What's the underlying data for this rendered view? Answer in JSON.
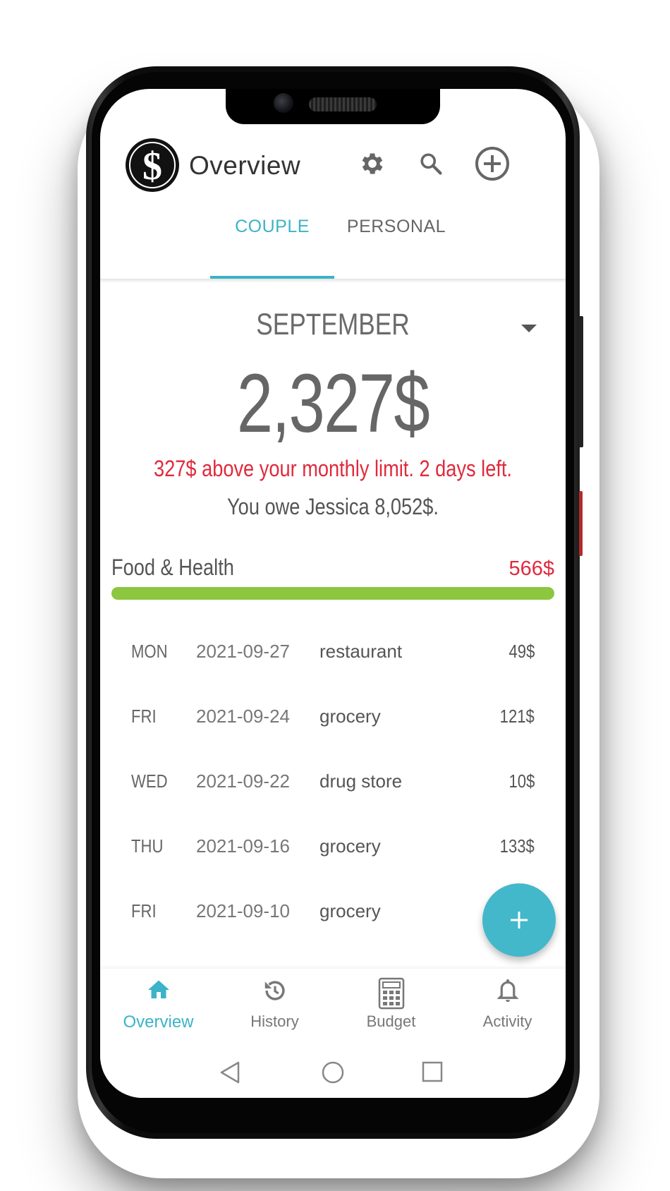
{
  "header": {
    "title": "Overview",
    "logo_icon": "dollar-logo-icon",
    "icons": [
      "gear-icon",
      "search-icon",
      "add-circle-icon"
    ]
  },
  "tabs": [
    {
      "label": "COUPLE",
      "active": true
    },
    {
      "label": "PERSONAL",
      "active": false
    }
  ],
  "summary": {
    "month": "SEPTEMBER",
    "total": "2,327$",
    "warning": "327$ above your monthly limit. 2 days left.",
    "owe": "You owe Jessica 8,052$."
  },
  "category": {
    "name": "Food & Health",
    "amount": "566$",
    "progress": 1.0,
    "bar_color": "#8dc63f"
  },
  "transactions": [
    {
      "day": "MON",
      "date": "2021-09-27",
      "description": "restaurant",
      "amount": "49$"
    },
    {
      "day": "FRI",
      "date": "2021-09-24",
      "description": "grocery",
      "amount": "121$"
    },
    {
      "day": "WED",
      "date": "2021-09-22",
      "description": "drug store",
      "amount": "10$"
    },
    {
      "day": "THU",
      "date": "2021-09-16",
      "description": "grocery",
      "amount": "133$"
    },
    {
      "day": "FRI",
      "date": "2021-09-10",
      "description": "grocery",
      "amount": ""
    }
  ],
  "bottom_nav": [
    {
      "label": "Overview",
      "icon": "home-icon",
      "active": true
    },
    {
      "label": "History",
      "icon": "history-icon",
      "active": false
    },
    {
      "label": "Budget",
      "icon": "calculator-icon",
      "active": false
    },
    {
      "label": "Activity",
      "icon": "bell-icon",
      "active": false
    }
  ],
  "colors": {
    "accent": "#3bb3c8",
    "warning": "#e02a3c",
    "progress": "#8dc63f"
  }
}
